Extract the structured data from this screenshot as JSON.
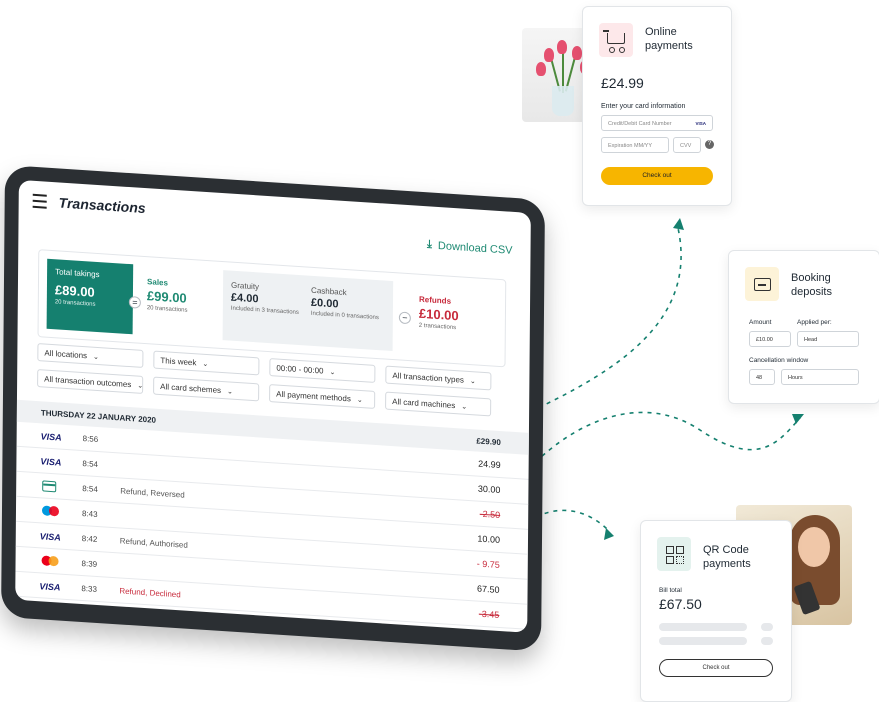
{
  "tablet": {
    "title": "Transactions",
    "download_label": "Download CSV",
    "summary": {
      "total_label": "Total takings",
      "total_value": "£89.00",
      "total_sub": "20 transactions",
      "sales_label": "Sales",
      "sales_value": "£99.00",
      "sales_sub": "20 transactions",
      "gratuity_label": "Gratuity",
      "gratuity_value": "£4.00",
      "gratuity_sub": "Included in 3 transactions",
      "cashback_label": "Cashback",
      "cashback_value": "£0.00",
      "cashback_sub": "Included in 0 transactions",
      "refunds_label": "Refunds",
      "refunds_value": "£10.00",
      "refunds_sub": "2 transactions"
    },
    "filters": [
      "All locations",
      "This week",
      "00:00 - 00:00",
      "All transaction types",
      "All transaction outcomes",
      "All card schemes",
      "All payment methods",
      "All card machines"
    ],
    "date_header": "THURSDAY 22 JANUARY 2020",
    "date_total": "£29.90",
    "transactions": [
      {
        "brand": "VISA",
        "time": "8:56",
        "status": "",
        "amount": "24.99"
      },
      {
        "brand": "VISA",
        "time": "8:54",
        "status": "",
        "amount": "30.00"
      },
      {
        "brand": "card",
        "time": "8:54",
        "status": "Refund, Reversed",
        "amount": "-2.50"
      },
      {
        "brand": "maestro",
        "time": "8:43",
        "status": "",
        "amount": "10.00"
      },
      {
        "brand": "VISA",
        "time": "8:42",
        "status": "Refund, Authorised",
        "amount": "- 9.75"
      },
      {
        "brand": "mastercard",
        "time": "8:39",
        "status": "",
        "amount": "67.50"
      },
      {
        "brand": "VISA",
        "time": "8:33",
        "status": "Refund, Declined",
        "amount": "-3.45"
      }
    ]
  },
  "online": {
    "title_line1": "Online",
    "title_line2": "payments",
    "price": "£24.99",
    "enter_label": "Enter your card information",
    "card_placeholder": "Credit/Debit Card Number",
    "card_brands": "VISA",
    "exp_placeholder": "Expiration MM/YY",
    "cvv_placeholder": "CVV",
    "help": "?",
    "checkout": "Check out",
    "icon": "shopping-cart-icon"
  },
  "booking": {
    "title_line1": "Booking",
    "title_line2": "deposits",
    "amount_label": "Amount",
    "applied_label": "Applied per:",
    "amount_value": "£10.00",
    "applied_value": "Head",
    "cancel_label": "Cancellation window",
    "cancel_value": "48",
    "cancel_unit": "Hours",
    "icon": "card-terminal-icon"
  },
  "qr": {
    "title_line1": "QR Code",
    "title_line2": "payments",
    "bill_label": "Bill total",
    "price": "£67.50",
    "checkout": "Check out",
    "icon": "qr-code-icon"
  },
  "colors": {
    "brand_green": "#15806f",
    "refund_red": "#c72a3b",
    "checkout_yellow": "#f7b500"
  }
}
